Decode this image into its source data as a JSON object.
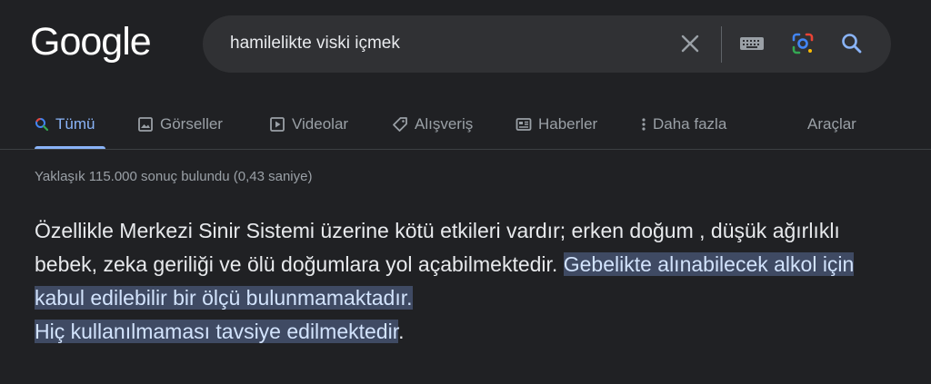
{
  "logo": {
    "text": "Google"
  },
  "search": {
    "query": "hamilelikte viski içmek",
    "icons": [
      "close-icon",
      "keyboard-icon",
      "lens-icon",
      "search-icon"
    ]
  },
  "tabs": [
    {
      "label": "Tümü",
      "icon": "search-icon",
      "active": true
    },
    {
      "label": "Görseller",
      "icon": "image-icon"
    },
    {
      "label": "Videolar",
      "icon": "video-icon"
    },
    {
      "label": "Alışveriş",
      "icon": "tag-icon"
    },
    {
      "label": "Haberler",
      "icon": "news-icon"
    },
    {
      "label": "Daha fazla",
      "icon": "more-vert-icon"
    }
  ],
  "tools_label": "Araçlar",
  "result_stats": "Yaklaşık 115.000 sonuç bulundu (0,43 saniye)",
  "snippet": {
    "text_plain": "Özellikle Merkezi Sinir Sistemi üzerine kötü etkileri vardır; erken doğum , düşük ağırlıklı bebek, zeka geriliği ve ölü doğumlara yol açabilmektedir. ",
    "text_highlighted_1": "Gebelikte alınabilecek alkol için kabul edilebilir bir ölçü bulunmamaktadır.",
    "text_highlighted_2": "Hiç kullanılmaması tavsiye edilmektedir",
    "text_tail": ".",
    "highlight_color": "#3f4a63"
  },
  "colors": {
    "background": "#202124",
    "search_bg": "#303134",
    "accent": "#8ab4f8",
    "muted": "#9aa0a6"
  }
}
